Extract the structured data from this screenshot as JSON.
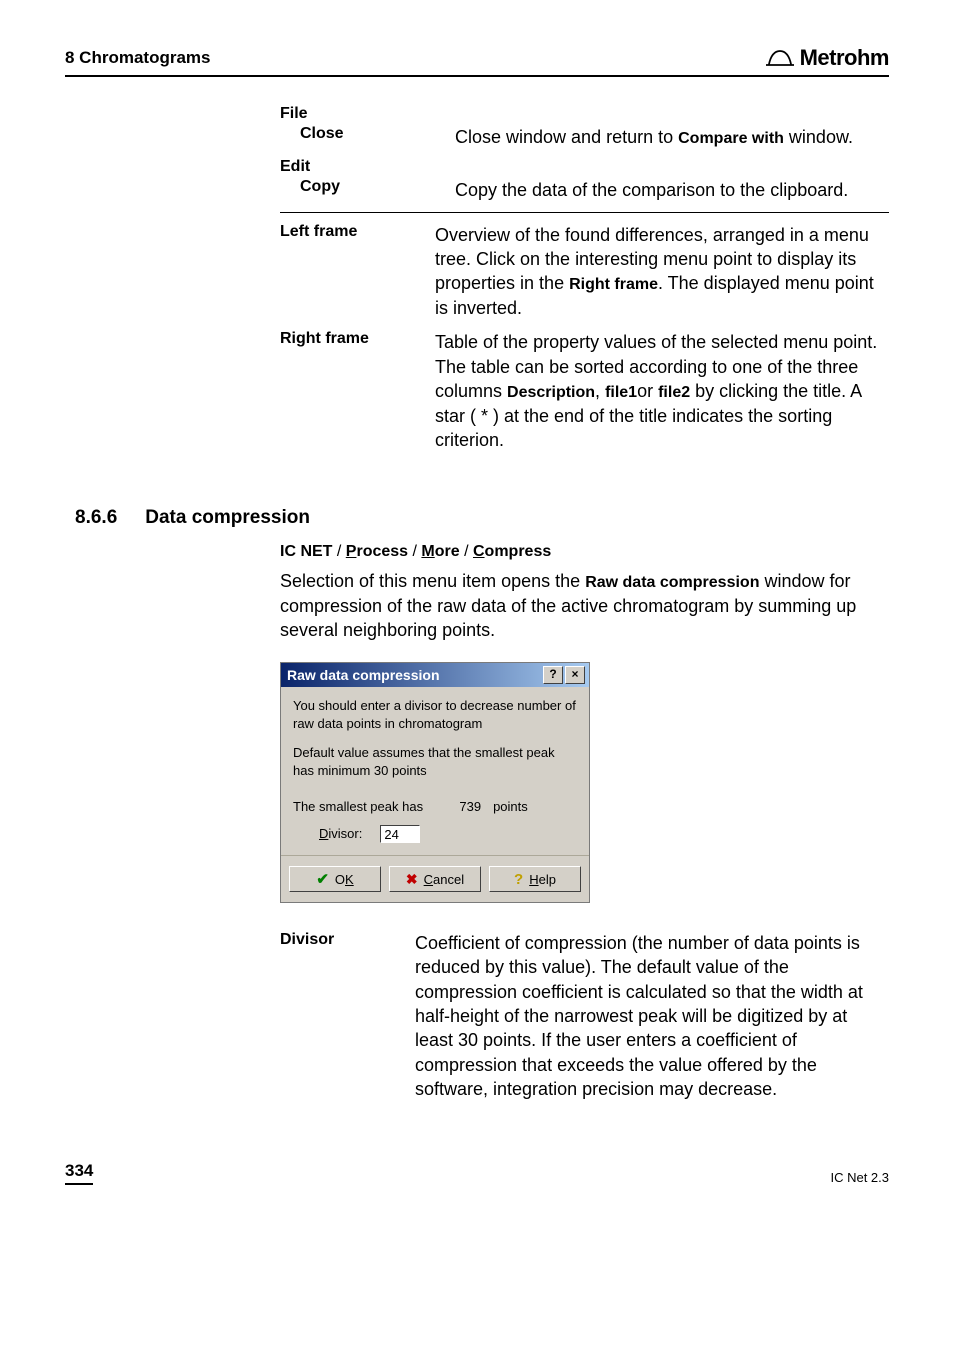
{
  "header": {
    "chapter": "8  Chromatograms",
    "brand": "Metrohm"
  },
  "defs1": {
    "file": "File",
    "close": "Close",
    "close_desc_pre": "Close window and return to ",
    "close_desc_bold": "Compare with",
    "close_desc_post": " window.",
    "edit": "Edit",
    "copy": "Copy",
    "copy_desc": "Copy the data of the comparison to the clipboard."
  },
  "defs2": {
    "left": "Left frame",
    "left_desc_1": "Overview of the found differences, arranged in a menu tree. Click on the interesting menu point to display its properties in the ",
    "left_desc_b1": "Right frame",
    "left_desc_2": ". The displayed menu point is inverted.",
    "right": "Right frame",
    "right_desc_1": "Table of the property values of the selected menu point. The table can be sorted according to one of the three columns ",
    "right_desc_b1": "Description",
    "right_desc_mid": ", ",
    "right_desc_b2": "file1",
    "right_desc_or": "or ",
    "right_desc_b3": "file2",
    "right_desc_2": " by clicking the title. A star ( * ) at the end of the title indicates the sorting criterion."
  },
  "section": {
    "num": "8.6.6",
    "title": "Data compression"
  },
  "menupath": {
    "app": "IC NET",
    "sep": " / ",
    "m1": "rocess",
    "m1u": "P",
    "m2": "ore",
    "m2u": "M",
    "m3": "ompress",
    "m3u": "C"
  },
  "intro": {
    "pre": "Selection of this menu item opens the ",
    "bold": "Raw data compression",
    "post": " window for compression of the raw data of the active chromatogram by summing up several neighboring points."
  },
  "dialog": {
    "title": "Raw data compression",
    "line1": "You should enter a divisor to decrease number of raw data points in chromatogram",
    "line2": "Default value assumes that the smallest peak has minimum 30 points",
    "peak_pre": "The smallest peak has",
    "peak_val": "739",
    "peak_post": "points",
    "divisor_label_u": "D",
    "divisor_label": "ivisor:",
    "divisor_val": "24",
    "ok_u": "K",
    "ok": "O",
    "cancel_u": "C",
    "cancel": "ancel",
    "help_u": "H",
    "help": "elp"
  },
  "divisor_def": {
    "term": "Divisor",
    "desc": "Coefficient of compression (the number of data points is reduced by this value). The default value of the compression coefficient is calculated so that the width at half-height of the narrowest peak will be digitized by at least 30 points. If the user enters a coefficient of compression that exceeds the value offered by the software, integration precision may decrease."
  },
  "footer": {
    "page": "334",
    "doc": "IC Net 2.3"
  }
}
